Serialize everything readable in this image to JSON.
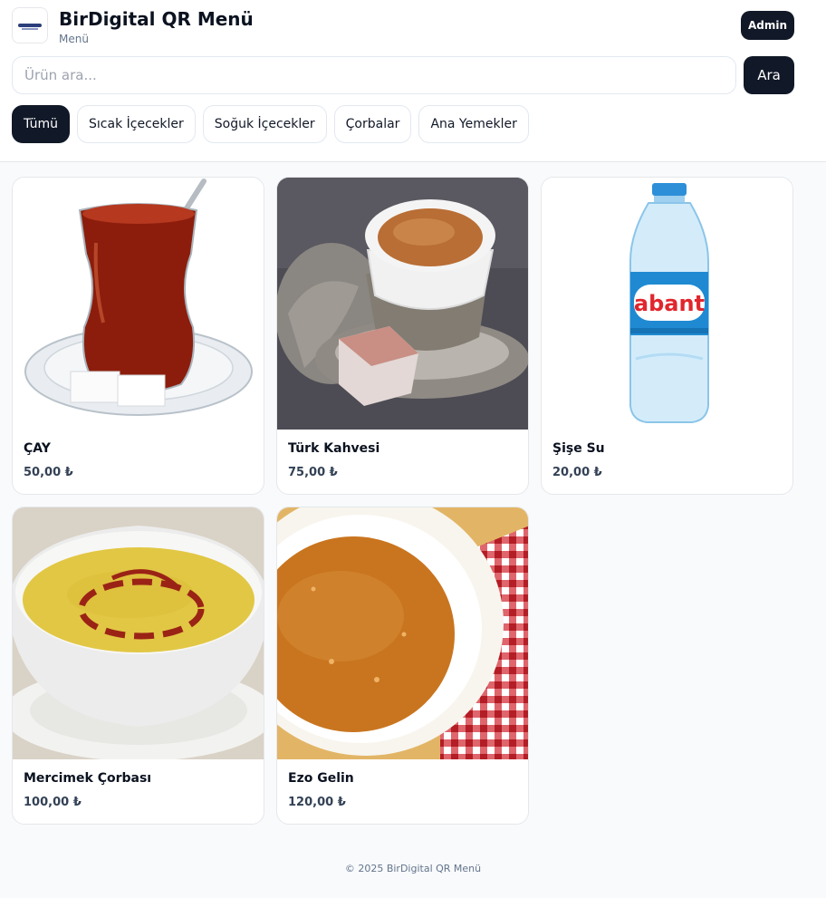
{
  "header": {
    "logo_icon": "birdigital-logo",
    "title": "BirDigital QR Menü",
    "subtitle": "Menü",
    "admin_label": "Admin"
  },
  "search": {
    "placeholder": "Ürün ara...",
    "value": "",
    "button_label": "Ara"
  },
  "categories": [
    {
      "label": "Tümü",
      "active": true
    },
    {
      "label": "Sıcak İçecekler",
      "active": false
    },
    {
      "label": "Soğuk İçecekler",
      "active": false
    },
    {
      "label": "Çorbalar",
      "active": false
    },
    {
      "label": "Ana Yemekler",
      "active": false
    }
  ],
  "products": [
    {
      "name": "ÇAY",
      "price": "50,00 ₺",
      "image": "turkish-tea-glass"
    },
    {
      "name": "Türk Kahvesi",
      "price": "75,00 ₺",
      "image": "turkish-coffee-cup"
    },
    {
      "name": "Şişe Su",
      "price": "20,00 ₺",
      "image": "water-bottle"
    },
    {
      "name": "Mercimek Çorbası",
      "price": "100,00 ₺",
      "image": "lentil-soup-bowl"
    },
    {
      "name": "Ezo Gelin",
      "price": "120,00 ₺",
      "image": "ezogelin-soup-bowl"
    }
  ],
  "footer": {
    "copyright": "© 2025 BirDigital QR Menü"
  },
  "colors": {
    "primary": "#111827",
    "background": "#f8fafc",
    "price_text": "#334155"
  }
}
